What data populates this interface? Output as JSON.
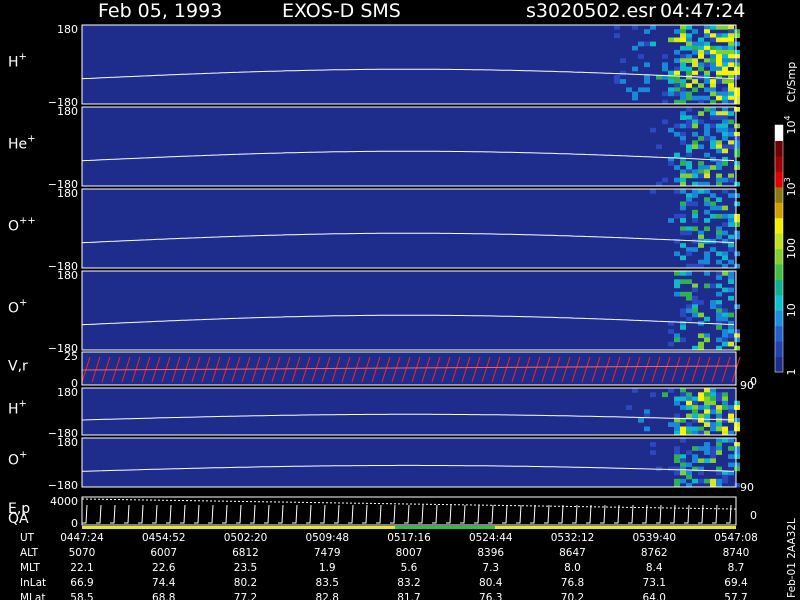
{
  "header": {
    "date": "Feb 05, 1993",
    "instrument": "EXOS-D SMS",
    "filename": "s3020502.esr",
    "time": "04:47:24"
  },
  "chart_data": {
    "type": "heatmap",
    "panels": [
      {
        "label": "H",
        "sup": "+",
        "ytop": "180",
        "ybot": "−180",
        "ylim": [
          -180,
          180
        ],
        "sat": 0.95
      },
      {
        "label": "He",
        "sup": "+",
        "ytop": "180",
        "ybot": "−180",
        "ylim": [
          -180,
          180
        ],
        "sat": 0.55
      },
      {
        "label": "O",
        "sup": "++",
        "ytop": "180",
        "ybot": "−180",
        "ylim": [
          -180,
          180
        ],
        "sat": 0.5
      },
      {
        "label": "O",
        "sup": "+",
        "ytop": "180",
        "ybot": "−180",
        "ylim": [
          -180,
          180
        ],
        "sat": 0.5
      },
      {
        "label": "V,r",
        "sup": "",
        "ytop": "25",
        "ybot": "0",
        "ylim": [
          0,
          25
        ],
        "right_tick": "90",
        "right_tick_bottom": "0"
      },
      {
        "label": "H",
        "sup": "+",
        "ytop": "180",
        "ybot": "−180",
        "ylim": [
          -180,
          180
        ],
        "sat": 0.85
      },
      {
        "label": "O",
        "sup": "+",
        "ytop": "180",
        "ybot": "−180",
        "ylim": [
          -180,
          180
        ],
        "sat": 0.55,
        "right_tick": "90"
      },
      {
        "label": "E,p",
        "label2": "QA",
        "sup": "",
        "ytop": "4000",
        "ybot": "0",
        "ylim": [
          0,
          4000
        ],
        "right_tick_bottom": "0"
      }
    ],
    "colorbar": {
      "title": "Ct/Smp",
      "ticks": [
        {
          "label": "1",
          "value": 1
        },
        {
          "label": "10",
          "value": 10
        },
        {
          "label": "100",
          "value": 100
        },
        {
          "label": "10",
          "sup": "3",
          "value": 1000
        },
        {
          "label": "10",
          "sup": "4",
          "value": 10000
        }
      ],
      "colors": [
        "#1e2d8c",
        "#1f44b0",
        "#2060d0",
        "#1a90e0",
        "#10c0d0",
        "#10b090",
        "#40c040",
        "#80d030",
        "#c0e020",
        "#f0f000",
        "#d0a000",
        "#8a7a10",
        "#e00000",
        "#a00000",
        "#700000",
        "#ffffff"
      ]
    },
    "footer": {
      "rows": [
        {
          "label": "UT",
          "values": [
            "0447:24",
            "0454:52",
            "0502:20",
            "0509:48",
            "0517:16",
            "0524:44",
            "0532:12",
            "0539:40",
            "0547:08"
          ]
        },
        {
          "label": "ALT",
          "values": [
            "5070",
            "6007",
            "6812",
            "7479",
            "8007",
            "8396",
            "8647",
            "8762",
            "8740"
          ]
        },
        {
          "label": "MLT",
          "values": [
            "22.1",
            "22.6",
            "23.5",
            "1.9",
            "5.6",
            "7.3",
            "8.0",
            "8.4",
            "8.7"
          ]
        },
        {
          "label": "InLat",
          "values": [
            "66.9",
            "74.4",
            "80.2",
            "83.5",
            "83.2",
            "80.4",
            "76.8",
            "73.1",
            "69.4"
          ]
        },
        {
          "label": "MLat",
          "values": [
            "58.5",
            "68.8",
            "77.2",
            "82.8",
            "81.7",
            "76.3",
            "70.2",
            "64.0",
            "57.7"
          ]
        }
      ],
      "side_label": "Feb-01 2AA32L"
    }
  }
}
